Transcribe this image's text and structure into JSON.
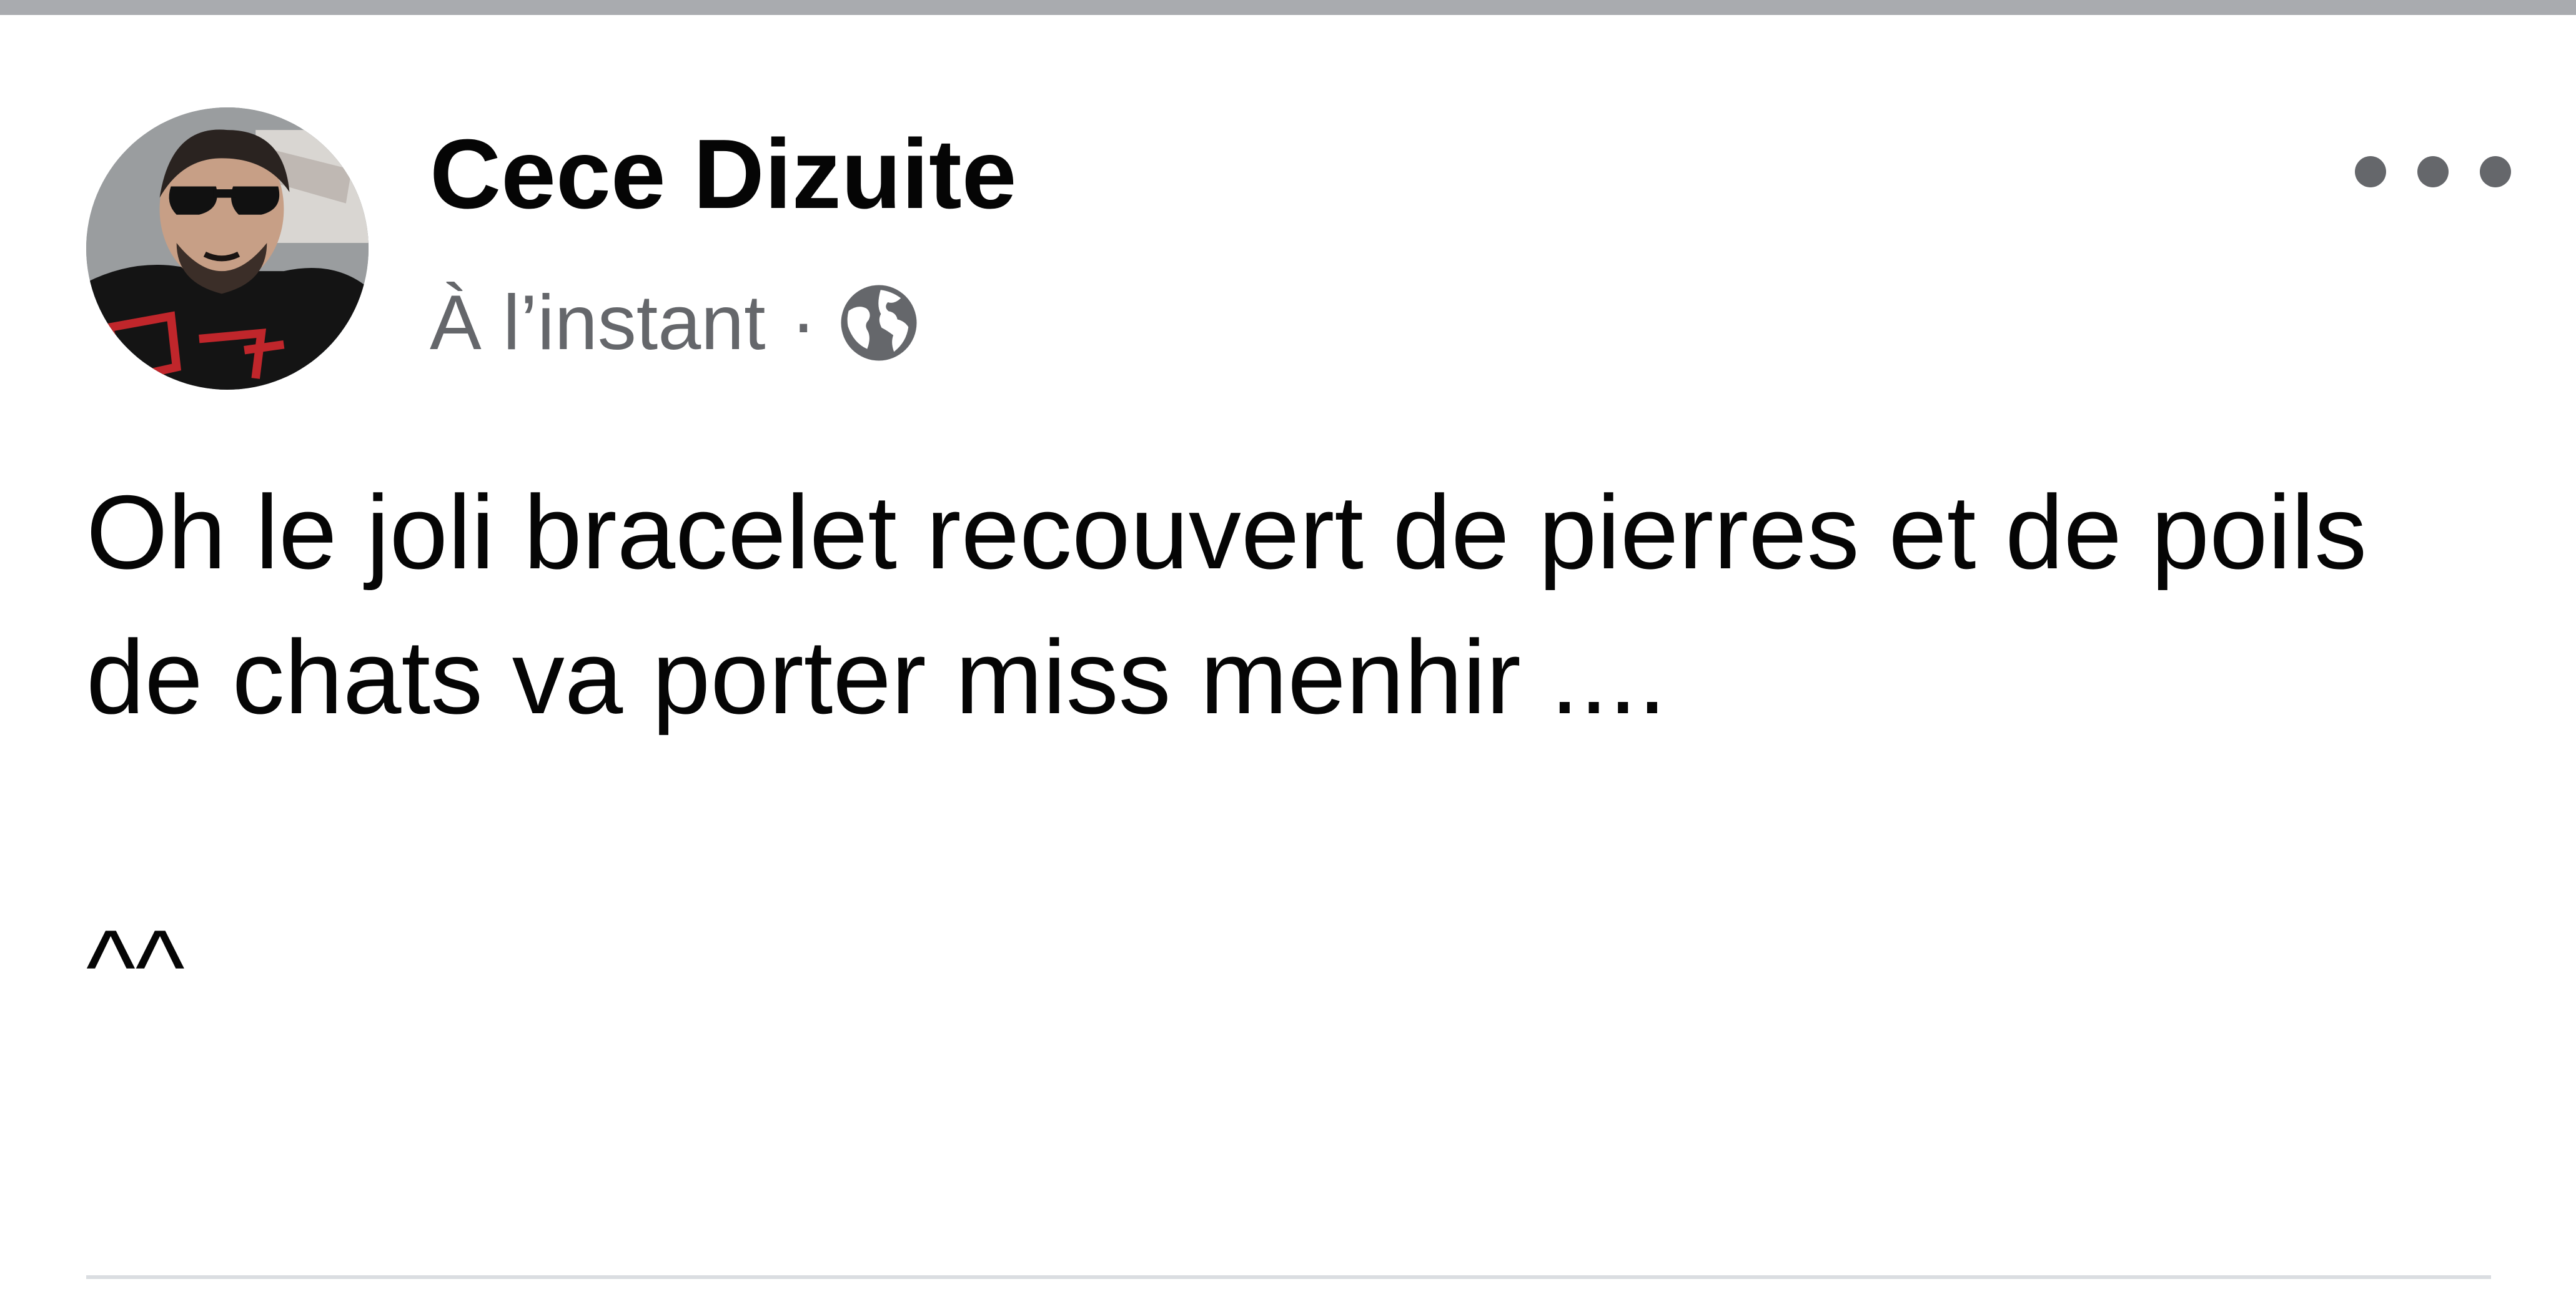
{
  "post": {
    "author_name": "Cece Dizuite",
    "timestamp": "À l’instant",
    "separator": "·",
    "privacy_icon": "globe-icon",
    "more_options_icon": "more-options-icon",
    "text_lines": [
      "Oh le joli bracelet recouvert de pierres et de poils de chats va porter miss menhir ....",
      "^^"
    ]
  },
  "colors": {
    "author_text": "#050505",
    "meta_text": "#65676b",
    "divider": "#dadde1",
    "top_rule": "#a9abaf"
  }
}
